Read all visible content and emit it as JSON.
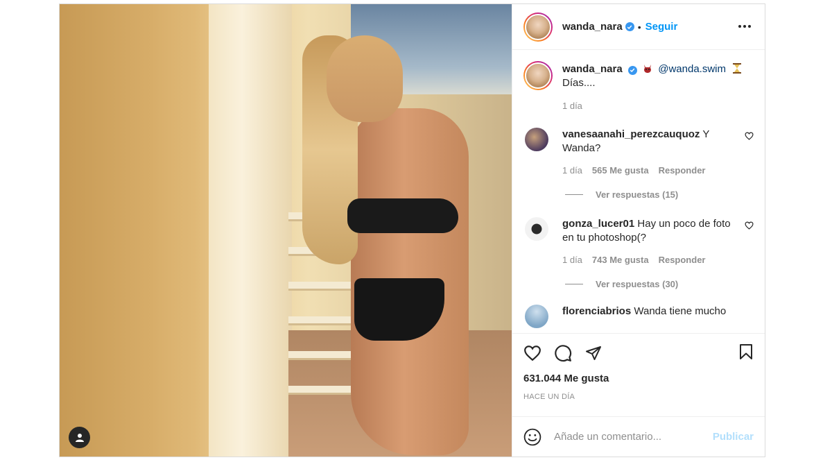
{
  "post": {
    "author": {
      "username": "wanda_nara",
      "verified": true,
      "follow_label": "Seguir",
      "follow_separator": "•"
    },
    "caption": {
      "username": "wanda_nara",
      "mention": "@wanda.swim",
      "text": "Días....",
      "time": "1 día",
      "emojis": [
        "devil-emoji",
        "hourglass-emoji"
      ]
    },
    "comments": [
      {
        "username": "vanesaanahi_perezcauquoz",
        "text": "Y Wanda?",
        "time": "1 día",
        "likes": "565 Me gusta",
        "reply_label": "Responder",
        "view_replies": "Ver respuestas (15)",
        "avatar_color": "#5b4a6a"
      },
      {
        "username": "gonza_lucer01",
        "text": "Hay un poco de foto en tu photoshop(?",
        "time": "1 día",
        "likes": "743 Me gusta",
        "reply_label": "Responder",
        "view_replies": "Ver respuestas (30)",
        "avatar_color": "#d8d8d8"
      },
      {
        "username": "florenciabrios",
        "text": "Wanda tiene mucho",
        "avatar_color": "#8fb3cf"
      }
    ],
    "likes_count": "631.044 Me gusta",
    "posted": "HACE UN DÍA",
    "add_comment": {
      "placeholder": "Añade un comentario...",
      "publish_label": "Publicar"
    },
    "colors": {
      "link_blue": "#0095f6",
      "verified_blue": "#3897f0",
      "muted": "#8e8e8e",
      "publish_disabled": "#b2dffc"
    }
  }
}
